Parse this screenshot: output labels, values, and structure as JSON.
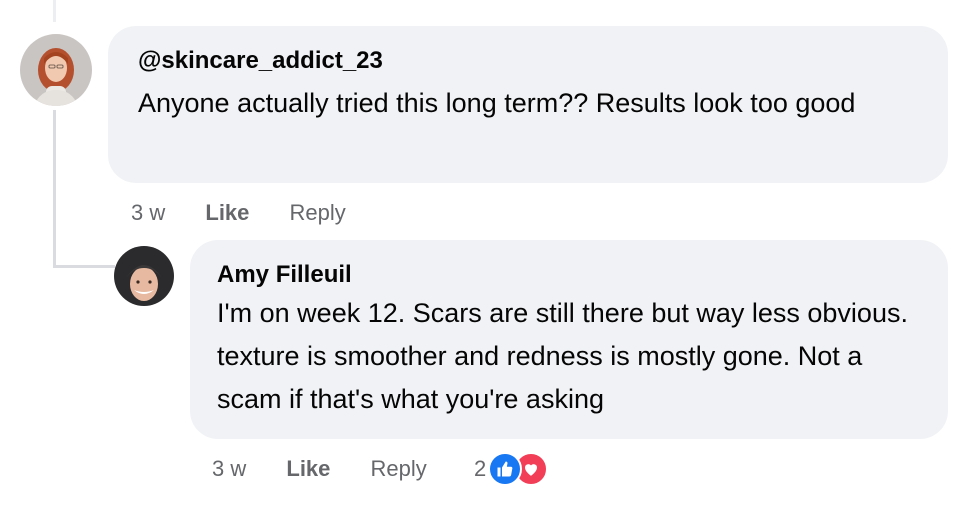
{
  "comments": [
    {
      "author": "@skincare_addict_23",
      "text": "Anyone actually tried this long term?? Results look too good",
      "time": "3 w",
      "like_label": "Like",
      "reply_label": "Reply",
      "avatar_icon": "avatar-woman-red-hair"
    }
  ],
  "reply": {
    "author": "Amy Filleuil",
    "text": "I'm on week 12. Scars are still there but way less obvious. texture is smoother and redness is mostly gone. Not a scam if that's what you're asking",
    "time": "3 w",
    "like_label": "Like",
    "reply_label": "Reply",
    "reaction_count": "2",
    "reaction_icons": [
      "like-icon",
      "love-icon"
    ],
    "avatar_icon": "avatar-woman-beanie"
  },
  "colors": {
    "bubble": "#f0f2f5",
    "meta_text": "#65676b",
    "like_blue": "#1877f2",
    "love_red": "#f33e58",
    "thread_line": "#d9dbe0"
  }
}
